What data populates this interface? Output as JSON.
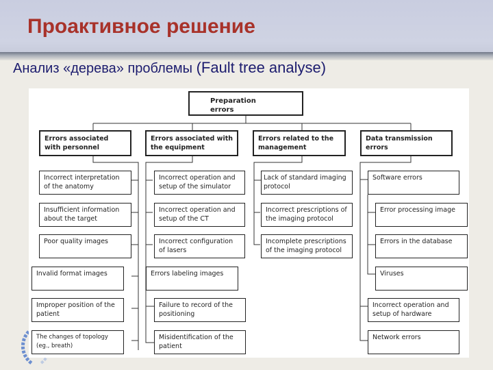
{
  "slide": {
    "title": "Проактивное решение",
    "subtitle_ru": "Анализ «дерева» проблемы ",
    "subtitle_en": "(Fault tree analyse)",
    "colors": {
      "title": "#a8322a",
      "subtitle": "#1c1c6e",
      "header_band": "#cfd3e3"
    }
  },
  "tree": {
    "root": "Preparation errors",
    "categories": [
      {
        "label": "Errors associated with personnel",
        "children": [
          "Incorrect interpretation of the anatomy",
          "Insufficient information about the target",
          "Poor quality images",
          "Invalid format images",
          "Improper position of the patient",
          "The changes of topology (eg., breath)"
        ]
      },
      {
        "label": "Errors associated with the equipment",
        "children": [
          "Incorrect operation and setup of the simulator",
          "Incorrect operation and setup of the CT",
          "Incorrect configuration of lasers",
          "Errors labeling images",
          "Failure to record of the positioning",
          "Misidentification of the patient"
        ]
      },
      {
        "label": "Errors related to the management",
        "children": [
          "Lack of standard imaging protocol",
          "Incorrect prescriptions of the imaging protocol",
          "Incomplete prescriptions of the imaging protocol"
        ]
      },
      {
        "label": "Data transmission errors",
        "children": [
          "Software errors",
          "Error processing image",
          "Errors in the database",
          "Viruses",
          "Incorrect operation and setup of hardware",
          "Network errors"
        ]
      }
    ]
  }
}
